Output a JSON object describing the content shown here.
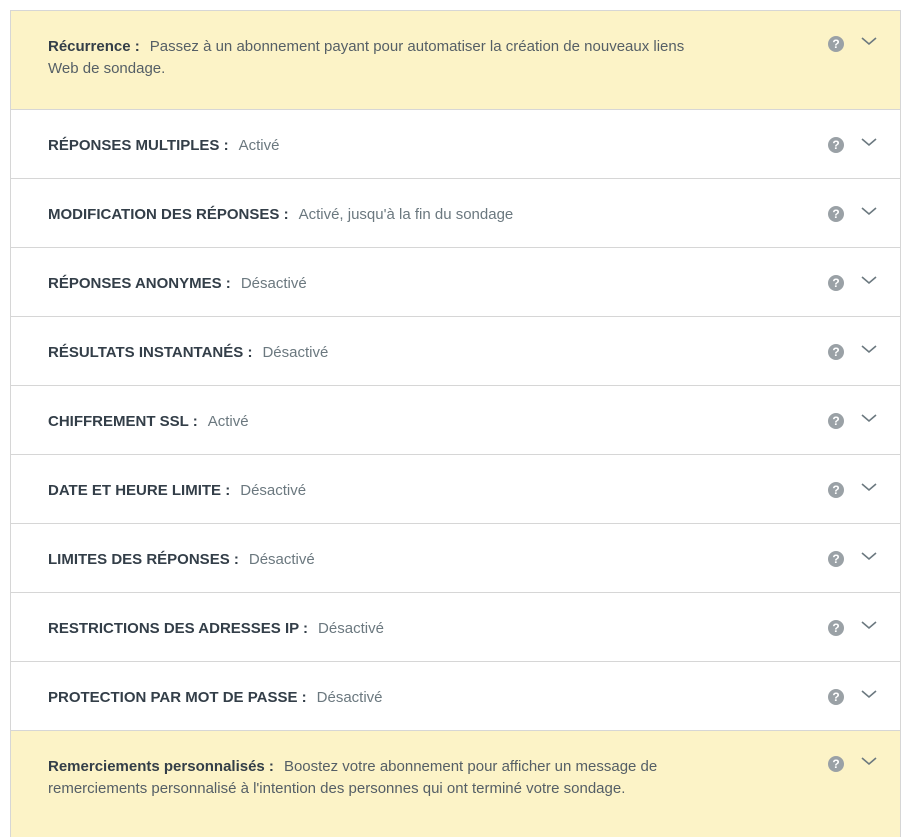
{
  "rows": [
    {
      "id": "recurrence",
      "promo": true,
      "label": "Récurrence :",
      "value": "Passez à un abonnement payant pour automatiser la création de nouveaux liens Web de sondage."
    },
    {
      "id": "multiple-responses",
      "promo": false,
      "label": "RÉPONSES MULTIPLES :",
      "value": "Activé"
    },
    {
      "id": "edit-responses",
      "promo": false,
      "label": "MODIFICATION DES RÉPONSES :",
      "value": "Activé, jusqu'à la fin du sondage"
    },
    {
      "id": "anonymous-responses",
      "promo": false,
      "label": "RÉPONSES ANONYMES :",
      "value": "Désactivé"
    },
    {
      "id": "instant-results",
      "promo": false,
      "label": "RÉSULTATS INSTANTANÉS :",
      "value": "Désactivé"
    },
    {
      "id": "ssl-encryption",
      "promo": false,
      "label": "CHIFFREMENT SSL :",
      "value": "Activé"
    },
    {
      "id": "cutoff-date",
      "promo": false,
      "label": "DATE ET HEURE LIMITE :",
      "value": "Désactivé"
    },
    {
      "id": "response-limits",
      "promo": false,
      "label": "LIMITES DES RÉPONSES :",
      "value": "Désactivé"
    },
    {
      "id": "ip-restrictions",
      "promo": false,
      "label": "RESTRICTIONS DES ADRESSES IP :",
      "value": "Désactivé"
    },
    {
      "id": "password-protection",
      "promo": false,
      "label": "PROTECTION PAR MOT DE PASSE :",
      "value": "Désactivé"
    },
    {
      "id": "custom-thank-you",
      "promo": true,
      "label": "Remerciements personnalisés :",
      "value": "Boostez votre abonnement pour afficher un message de remerciements personnalisé à l'intention des personnes qui ont terminé votre sondage."
    }
  ],
  "icons": {
    "help": "help-icon",
    "help_glyph": "?",
    "expand": "chevron-down-icon"
  },
  "colors": {
    "promo_background": "#fcf3c7",
    "border": "#d6d6d6",
    "label": "#333e48",
    "value": "#6b787f",
    "icon": "#9aa1a6"
  }
}
